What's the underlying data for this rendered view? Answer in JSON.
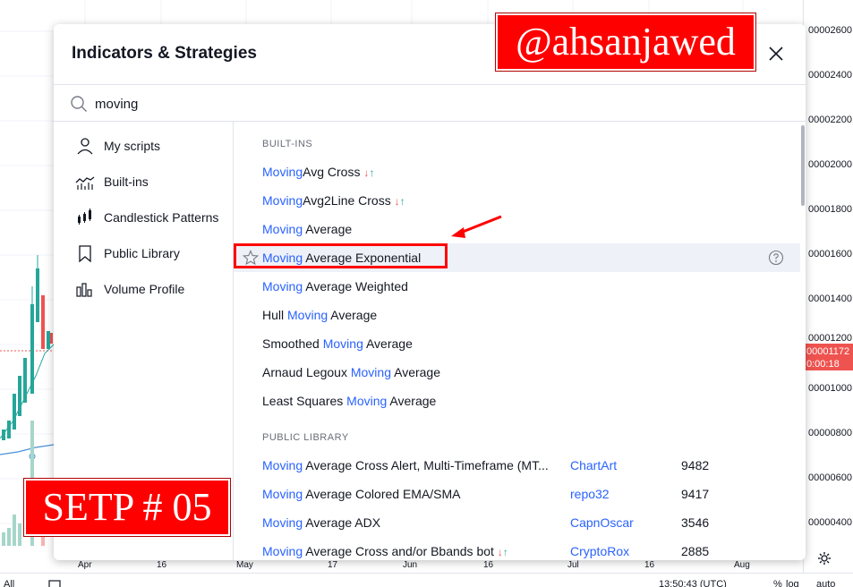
{
  "dialog": {
    "title": "Indicators & Strategies",
    "close_icon": "close-icon"
  },
  "search": {
    "value": "moving",
    "icon": "search-icon"
  },
  "sidebar": {
    "items": [
      {
        "label": "My scripts",
        "icon": "user-icon"
      },
      {
        "label": "Built-ins",
        "icon": "built-ins-chart-icon"
      },
      {
        "label": "Candlestick Patterns",
        "icon": "candlestick-icon"
      },
      {
        "label": "Public Library",
        "icon": "bookmark-icon"
      },
      {
        "label": "Volume Profile",
        "icon": "volume-profile-icon"
      }
    ]
  },
  "results": {
    "builtins_header": "BUILT-INS",
    "builtins": [
      {
        "hit": "Moving",
        "rest": "Avg Cross",
        "pre": "",
        "arrows": true
      },
      {
        "hit": "Moving",
        "rest": "Avg2Line Cross",
        "pre": "",
        "arrows": true
      },
      {
        "hit": "Moving",
        "rest": " Average",
        "pre": "",
        "arrows": false
      },
      {
        "hit": "Moving",
        "rest": " Average Exponential",
        "pre": "",
        "arrows": false,
        "highlighted": true
      },
      {
        "hit": "Moving",
        "rest": " Average Weighted",
        "pre": "",
        "arrows": false
      },
      {
        "pre": "Hull ",
        "hit": "Moving",
        "rest": " Average",
        "arrows": false
      },
      {
        "pre": "Smoothed ",
        "hit": "Moving",
        "rest": " Average",
        "arrows": false
      },
      {
        "pre": "Arnaud Legoux ",
        "hit": "Moving",
        "rest": " Average",
        "arrows": false
      },
      {
        "pre": "Least Squares ",
        "hit": "Moving",
        "rest": " Average",
        "arrows": false
      }
    ],
    "public_header": "PUBLIC LIBRARY",
    "public": [
      {
        "hit": "Moving",
        "rest": " Average Cross Alert, Multi-Timeframe (MT...",
        "author": "ChartArt",
        "likes": "9482",
        "arrows": false
      },
      {
        "hit": "Moving",
        "rest": " Average Colored EMA/SMA",
        "author": "repo32",
        "likes": "9417",
        "arrows": false
      },
      {
        "hit": "Moving",
        "rest": " Average ADX",
        "author": "CapnOscar",
        "likes": "3546",
        "arrows": false
      },
      {
        "hit": "Moving",
        "rest": " Average Cross and/or Bbands bot",
        "author": "CryptoRox",
        "likes": "2885",
        "arrows": true
      }
    ],
    "arrow_down": "↓",
    "arrow_up": "↑"
  },
  "price_scale": {
    "labels": [
      "00002600",
      "00002400",
      "00002200",
      "00002000",
      "00001800",
      "00001600",
      "00001400",
      "00001200",
      "00001000",
      "00000800",
      "00000600",
      "00000400"
    ],
    "tag_price": "00001172",
    "tag_time": "0:00:18"
  },
  "time_scale": {
    "labels": [
      "Apr",
      "16",
      "May",
      "17",
      "Jun",
      "16",
      "Jul",
      "16",
      "Aug"
    ]
  },
  "bottom_bar": {
    "range_label": "All",
    "clock": "13:50:43 (UTC)",
    "percent_label": "%",
    "log_label": "log",
    "auto_label": "auto"
  },
  "overlays": {
    "watermark": "@ahsanjawed",
    "step": "SETP # 05"
  },
  "colors": {
    "accent": "#2962ff",
    "highlight_row": "#eef1f8",
    "annotation_red": "#ff0000",
    "up": "#26a69a",
    "down": "#ef5350"
  }
}
